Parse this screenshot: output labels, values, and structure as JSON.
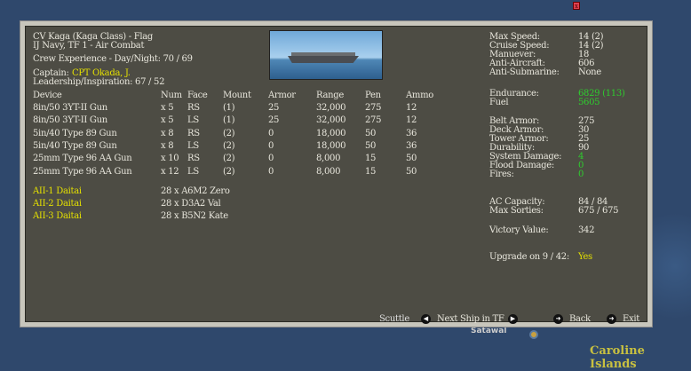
{
  "header": {
    "title": "CV Kaga (Kaga Class) - Flag",
    "subtitle": "IJ Navy, TF 1 - Air Combat",
    "crew_experience": "Crew Experience - Day/Night:  70 / 69",
    "captain_label": "Captain:",
    "captain_name": "CPT Okada, J.",
    "leadership": "Leadership/Inspiration: 67 / 52"
  },
  "devices": {
    "headers": [
      "Device",
      "Num",
      "Face",
      "Mount",
      "Armor",
      "Range",
      "Pen",
      "Ammo"
    ],
    "rows": [
      [
        "8in/50 3YT-II Gun",
        "x 5",
        "RS",
        "(1)",
        "25",
        "32,000",
        "275",
        "12"
      ],
      [
        "8in/50 3YT-II Gun",
        "x 5",
        "LS",
        "(1)",
        "25",
        "32,000",
        "275",
        "12"
      ],
      [
        "5in/40 Type 89 Gun",
        "x 8",
        "RS",
        "(2)",
        "0",
        "18,000",
        "50",
        "36"
      ],
      [
        "5in/40 Type 89 Gun",
        "x 8",
        "LS",
        "(2)",
        "0",
        "18,000",
        "50",
        "36"
      ],
      [
        "25mm Type 96 AA Gun",
        "x 10",
        "RS",
        "(2)",
        "0",
        "8,000",
        "15",
        "50"
      ],
      [
        "25mm Type 96 AA Gun",
        "x 12",
        "LS",
        "(2)",
        "0",
        "8,000",
        "15",
        "50"
      ]
    ]
  },
  "air_groups": [
    {
      "name": "AII-1 Daitai",
      "aircraft": "28 x A6M2 Zero"
    },
    {
      "name": "AII-2 Daitai",
      "aircraft": "28 x D3A2 Val"
    },
    {
      "name": "AII-3 Daitai",
      "aircraft": "28 x B5N2 Kate"
    }
  ],
  "stats": [
    {
      "label": "Max Speed:",
      "value": "14 (2)"
    },
    {
      "label": "Cruise Speed:",
      "value": "14 (2)"
    },
    {
      "label": "Manuever:",
      "value": "18"
    },
    {
      "label": "Anti-Aircraft:",
      "value": "606"
    },
    {
      "label": "Anti-Submarine:",
      "value": "None"
    },
    {
      "label": "Endurance:",
      "value": "6829 (113)"
    },
    {
      "label": "Fuel",
      "value": "5605"
    },
    {
      "label": "Belt Armor:",
      "value": "275"
    },
    {
      "label": "Deck Armor:",
      "value": "30"
    },
    {
      "label": "Tower Armor:",
      "value": "25"
    },
    {
      "label": "Durability:",
      "value": "90"
    },
    {
      "label": "System Damage:",
      "value": "4"
    },
    {
      "label": "Flood Damage:",
      "value": "0"
    },
    {
      "label": "Fires:",
      "value": "0"
    },
    {
      "label": "AC Capacity:",
      "value": "84 / 84"
    },
    {
      "label": "Max Sorties:",
      "value": "675 / 675"
    },
    {
      "label": "Victory Value:",
      "value": "342"
    },
    {
      "label": "Upgrade on 9 / 42:",
      "value": "Yes"
    }
  ],
  "footer": {
    "scuttle": "Scuttle",
    "next_ship": "Next Ship in TF",
    "back": "Back",
    "exit": "Exit"
  },
  "map": {
    "region": "Caroline Islands",
    "place": "Satawal"
  },
  "colors": {
    "highlight": "#e4e000",
    "good": "#2ecc2e",
    "panel": "#4d4c44"
  }
}
